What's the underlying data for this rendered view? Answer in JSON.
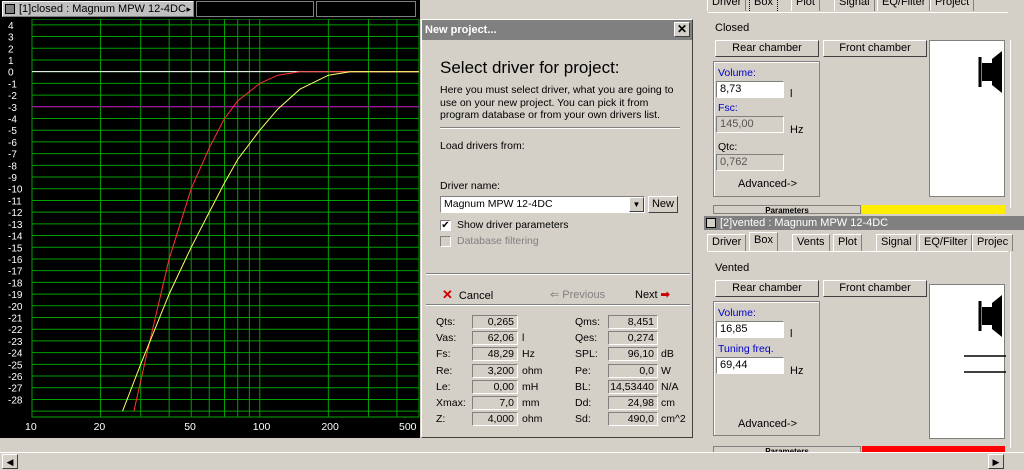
{
  "plot_window": {
    "title": "[1]closed : Magnum MPW 12-4DC"
  },
  "chart_data": {
    "type": "line",
    "x_scale": "log",
    "xlim": [
      10,
      500
    ],
    "ylim": [
      -29,
      4
    ],
    "x_ticks": [
      "10",
      "20",
      "50",
      "100",
      "200",
      "500"
    ],
    "x_tick_values": [
      10,
      20,
      50,
      100,
      200,
      500
    ],
    "y_ticks": [
      "4",
      "3",
      "2",
      "1",
      "0",
      "-1",
      "-2",
      "-3",
      "-4",
      "-5",
      "-6",
      "-7",
      "-8",
      "-9",
      "-10",
      "-11",
      "-12",
      "-13",
      "-14",
      "-15",
      "-16",
      "-17",
      "-18",
      "-19",
      "-20",
      "-21",
      "-22",
      "-23",
      "-24",
      "-25",
      "-26",
      "-27",
      "-28"
    ],
    "grid": true,
    "reference_lines": [
      {
        "y": 0,
        "color": "#ffffff"
      },
      {
        "y": -3,
        "color": "#cc00cc"
      }
    ],
    "series": [
      {
        "color": "#ff3333",
        "points": [
          [
            28,
            -29
          ],
          [
            32,
            -24
          ],
          [
            40,
            -16
          ],
          [
            50,
            -10
          ],
          [
            60,
            -6.5
          ],
          [
            70,
            -4
          ],
          [
            80,
            -2.5
          ],
          [
            100,
            -1
          ],
          [
            120,
            -0.3
          ],
          [
            150,
            0
          ],
          [
            300,
            0
          ],
          [
            500,
            0
          ]
        ]
      },
      {
        "color": "#ffff66",
        "points": [
          [
            25,
            -29
          ],
          [
            30,
            -25
          ],
          [
            40,
            -19
          ],
          [
            50,
            -15
          ],
          [
            60,
            -12
          ],
          [
            70,
            -9.5
          ],
          [
            80,
            -7.5
          ],
          [
            100,
            -5
          ],
          [
            120,
            -3.2
          ],
          [
            150,
            -1.5
          ],
          [
            200,
            -0.3
          ],
          [
            250,
            0
          ],
          [
            300,
            0
          ],
          [
            500,
            0
          ]
        ]
      }
    ]
  },
  "dialog": {
    "title": "New project...",
    "close_label": "✕",
    "heading": "Select driver for project:",
    "description": "Here you must select driver, what you are going to use on your new project. You can pick it from program database or from your own drivers list.",
    "load_from_label": "Load drivers from:",
    "driver_name_label": "Driver name:",
    "driver_name_value": "Magnum MPW 12-4DC",
    "new_button": "New",
    "show_params_label": "Show driver parameters",
    "show_params_checked": true,
    "db_filter_label": "Database filtering",
    "db_filter_checked": false,
    "cancel_label": "Cancel",
    "previous_label": "Previous",
    "next_label": "Next",
    "params_left": [
      {
        "label": "Qts:",
        "value": "0,265",
        "unit": ""
      },
      {
        "label": "Vas:",
        "value": "62,06",
        "unit": "l"
      },
      {
        "label": "Fs:",
        "value": "48,29",
        "unit": "Hz"
      },
      {
        "label": "Re:",
        "value": "3,200",
        "unit": "ohm"
      },
      {
        "label": "Le:",
        "value": "0,00",
        "unit": "mH"
      },
      {
        "label": "Xmax:",
        "value": "7,0",
        "unit": "mm"
      },
      {
        "label": "Z:",
        "value": "4,000",
        "unit": "ohm"
      }
    ],
    "params_right": [
      {
        "label": "Qms:",
        "value": "8,451",
        "unit": ""
      },
      {
        "label": "Qes:",
        "value": "0,274",
        "unit": ""
      },
      {
        "label": "SPL:",
        "value": "96,10",
        "unit": "dB"
      },
      {
        "label": "Pe:",
        "value": "0,0",
        "unit": "W"
      },
      {
        "label": "BL:",
        "value": "14,53440",
        "unit": "N/A"
      },
      {
        "label": "Dd:",
        "value": "24,98",
        "unit": "cm"
      },
      {
        "label": "Sd:",
        "value": "490,0",
        "unit": "cm^2"
      }
    ]
  },
  "closed_panel": {
    "tabs": [
      "Driver",
      "Box",
      "Plot",
      "Signal",
      "EQ/Filter",
      "Project"
    ],
    "active_tab": "Box",
    "box_type": "Closed",
    "rear_button": "Rear chamber",
    "front_button": "Front chamber",
    "volume_label": "Volume:",
    "volume_value": "8,73",
    "volume_unit": "l",
    "fsc_label": "Fsc:",
    "fsc_value": "145,00",
    "fsc_unit": "Hz",
    "qtc_label": "Qtc:",
    "qtc_value": "0,762",
    "advanced_label": "Advanced->",
    "parameters_label": "Parameters",
    "status_color": "#ffee00"
  },
  "vented_panel": {
    "title": "[2]vented : Magnum MPW 12-4DC",
    "tabs": [
      "Driver",
      "Box",
      "Vents",
      "Plot",
      "Signal",
      "EQ/Filter",
      "Projec"
    ],
    "active_tab": "Box",
    "box_type": "Vented",
    "rear_button": "Rear chamber",
    "front_button": "Front chamber",
    "volume_label": "Volume:",
    "volume_value": "16,85",
    "volume_unit": "l",
    "tuning_label": "Tuning freq.",
    "tuning_value": "69,44",
    "tuning_unit": "Hz",
    "advanced_label": "Advanced->",
    "parameters_label": "Parameters",
    "status_color": "#ff0000"
  }
}
